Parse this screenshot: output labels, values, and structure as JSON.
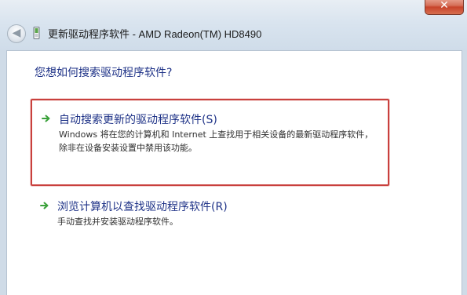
{
  "window": {
    "title": "更新驱动程序软件 - AMD Radeon(TM) HD8490",
    "close_label": "✕",
    "back_label": "◀"
  },
  "question": "您想如何搜索驱动程序软件?",
  "options": [
    {
      "title": "自动搜索更新的驱动程序软件(S)",
      "description": "Windows 将在您的计算机和 Internet 上查找用于相关设备的最新驱动程序软件，除非在设备安装设置中禁用该功能。",
      "highlighted": true
    },
    {
      "title": "浏览计算机以查找驱动程序软件(R)",
      "description": "手动查找并安装驱动程序软件。",
      "highlighted": false
    }
  ],
  "icons": {
    "back": "back-arrow-icon",
    "device": "device-driver-icon",
    "option_arrow": "green-arrow-icon"
  },
  "colors": {
    "link_text": "#1e3287",
    "highlight_border": "#c9403d",
    "arrow_green": "#3aa13a",
    "close_button": "#c7432b"
  }
}
